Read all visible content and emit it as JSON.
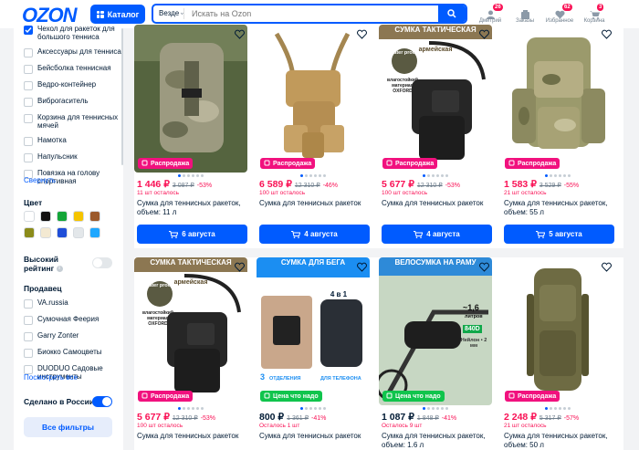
{
  "header": {
    "logo": "OZON",
    "catalog_label": "Каталог",
    "search_scope": "Везде",
    "search_placeholder": "Искать на Ozon",
    "icons": [
      {
        "label": "Дмитрий",
        "badge": "26",
        "icon": "user-icon"
      },
      {
        "label": "Заказы",
        "badge": "",
        "icon": "box-icon"
      },
      {
        "label": "Избранное",
        "badge": "62",
        "icon": "heart-icon"
      },
      {
        "label": "Корзина",
        "badge": "3",
        "icon": "cart-icon"
      }
    ]
  },
  "sidebar": {
    "top_items": [
      {
        "label": "Чехол для ракеток для большого тенниса",
        "checked": true
      },
      {
        "label": "Аксессуары для тенниса",
        "checked": false
      },
      {
        "label": "Бейсболка теннисная",
        "checked": false
      },
      {
        "label": "Ведро-контейнер",
        "checked": false
      },
      {
        "label": "Виброгаситель",
        "checked": false
      },
      {
        "label": "Корзина для теннисных мячей",
        "checked": false
      },
      {
        "label": "Намотка",
        "checked": false
      },
      {
        "label": "Напульсник",
        "checked": false
      },
      {
        "label": "Повязка на голову спортивная",
        "checked": false
      }
    ],
    "collapse_label": "Свернуть",
    "color_title": "Цвет",
    "colors": [
      "#ffffff",
      "#111111",
      "#13a538",
      "#f5c400",
      "#9c5a2c",
      "#8b8b1a",
      "#f3e9d2",
      "#1f4ed8",
      "#e3e7ea",
      "#1ea7ff"
    ],
    "high_rating_label": "Высокий рейтинг",
    "info_glyph": "i",
    "seller_title": "Продавец",
    "sellers": [
      {
        "label": "VA.russia"
      },
      {
        "label": "Сумочная Феерия"
      },
      {
        "label": "Garry Zonter"
      },
      {
        "label": "Биокко Самоцветы"
      },
      {
        "label": "DUODUO Садовые инструменты"
      }
    ],
    "show_all": "Посмотреть все",
    "made_in_russia": "Сделано в России",
    "all_filters": "Все фильтры"
  },
  "products": [
    {
      "tag": "Распродажа",
      "tag_color": "pink",
      "price": "1 446 ₽",
      "old": "3 087 ₽",
      "disc": "-53%",
      "left": "11 шт осталось",
      "title": "Сумка для теннисных ракеток, объем: 11 л",
      "button": "6 августа",
      "img": "camo-pack",
      "badges": []
    },
    {
      "tag": "Распродажа",
      "tag_color": "pink",
      "price": "6 589 ₽",
      "old": "12 310 ₽",
      "disc": "-46%",
      "left": "100 шт осталось",
      "title": "Сумка для теннисных ракеток",
      "button": "4 августа",
      "img": "tan-bag",
      "badges": []
    },
    {
      "tag": "Распродажа",
      "tag_color": "pink",
      "price": "5 677 ₽",
      "old": "12 310 ₽",
      "disc": "-53%",
      "left": "100 шт осталось",
      "title": "Сумка для теннисных ракеток",
      "button": "4 августа",
      "img": "black-bag",
      "banner": "СУМКА ТАКТИЧЕСКАЯ",
      "banner2": "армейская",
      "badges": [
        "water proof",
        "влагостойкий материал OXFORD"
      ]
    },
    {
      "tag": "Распродажа",
      "tag_color": "pink",
      "price": "1 583 ₽",
      "old": "3 529 ₽",
      "disc": "-55%",
      "left": "21 шт осталось",
      "title": "Сумка для теннисных ракеток, объем: 55 л",
      "button": "5 августа",
      "img": "camo-big",
      "badges": []
    },
    {
      "tag": "Распродажа",
      "tag_color": "pink",
      "price": "5 677 ₽",
      "old": "12 310 ₽",
      "disc": "-53%",
      "left": "100 шт осталось",
      "title": "Сумка для теннисных ракеток",
      "img": "black-bag",
      "banner": "СУМКА ТАКТИЧЕСКАЯ",
      "banner2": "армейская",
      "badges": [
        "water proof",
        "влагостойкий материал OXFORD"
      ]
    },
    {
      "tag": "Цена что надо",
      "tag_color": "green",
      "price": "800 ₽",
      "old": "1 361 ₽",
      "disc": "-41%",
      "left": "Осталось 1 шт",
      "title": "Сумка для теннисных ракеток",
      "img": "run-bag",
      "banner": "СУМКА ДЛЯ БЕГА",
      "banner2": "НА РУКУ",
      "banner3": "4 в 1",
      "badges": [
        "3",
        "ОТДЕЛЕНИЯ",
        "ДЛЯ ТЕЛЕФОНА"
      ]
    },
    {
      "tag": "Цена что надо",
      "tag_color": "green",
      "price": "1 087 ₽",
      "old": "1 848 ₽",
      "disc": "-41%",
      "left": "Осталось 9 шт",
      "title": "Сумка для теннисных ракеток, объем: 1.6 л",
      "img": "bike-bag",
      "banner": "ВЕЛОСУМКА НА РАМУ",
      "badges": [
        "~1,6",
        "литров",
        "840D",
        "Нейлон • 2 мм"
      ]
    },
    {
      "tag": "Распродажа",
      "tag_color": "pink",
      "price": "2 248 ₽",
      "old": "5 317 ₽",
      "disc": "-57%",
      "left": "21 шт осталось",
      "title": "Сумка для теннисных ракеток, объем: 50 л",
      "img": "olive-pack",
      "badges": []
    }
  ]
}
